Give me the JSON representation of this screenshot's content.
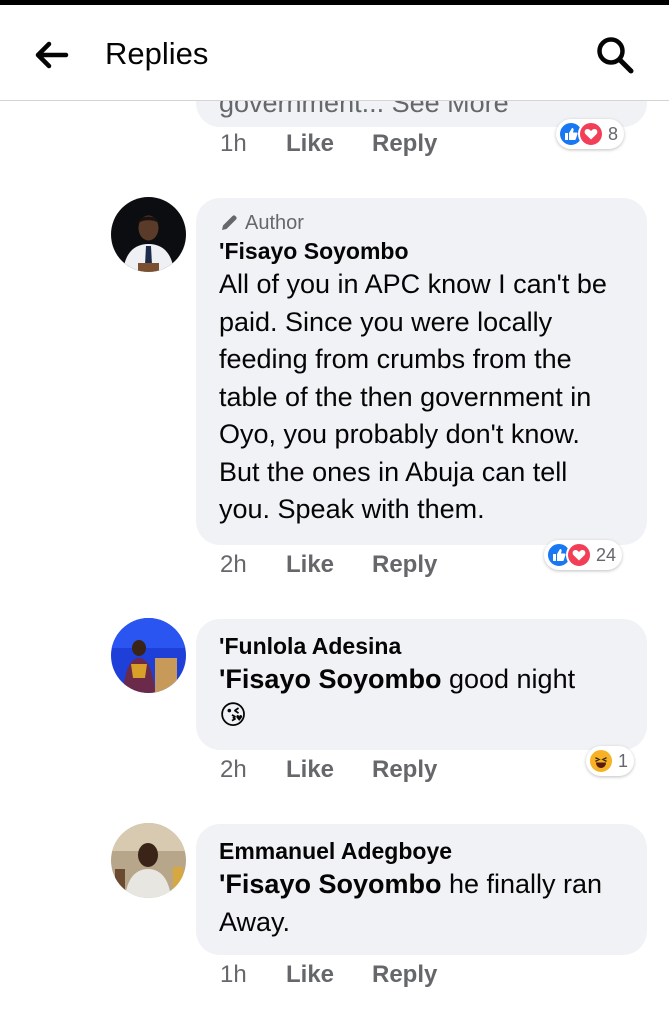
{
  "header": {
    "title": "Replies"
  },
  "comments": [
    {
      "partial_text": "government... See More",
      "time": "1h",
      "like": "Like",
      "reply": "Reply",
      "reactions": {
        "types": [
          "like",
          "love"
        ],
        "count": "8"
      }
    },
    {
      "author_badge": "Author",
      "name": "'Fisayo Soyombo",
      "text": "All of you in APC know I can't be paid. Since you were locally feeding from crumbs from the table of the then government in Oyo, you probably don't know. But the ones in Abuja can tell you. Speak with them.",
      "time": "2h",
      "like": "Like",
      "reply": "Reply",
      "reactions": {
        "types": [
          "like",
          "love"
        ],
        "count": "24"
      }
    },
    {
      "name": "'Funlola Adesina",
      "mention": "'Fisayo Soyombo",
      "text": " good night",
      "emoji": "😘",
      "time": "2h",
      "like": "Like",
      "reply": "Reply",
      "reactions": {
        "types": [
          "haha"
        ],
        "count": "1"
      }
    },
    {
      "name": "Emmanuel Adegboye",
      "mention": "'Fisayo Soyombo",
      "text": " he finally ran Away.",
      "time": "1h",
      "like": "Like",
      "reply": "Reply"
    }
  ],
  "colors": {
    "bubble": "#f0f2f5",
    "meta": "#65676b",
    "like": "#1877f2",
    "love": "#f33e58",
    "haha": "#f7b125"
  }
}
